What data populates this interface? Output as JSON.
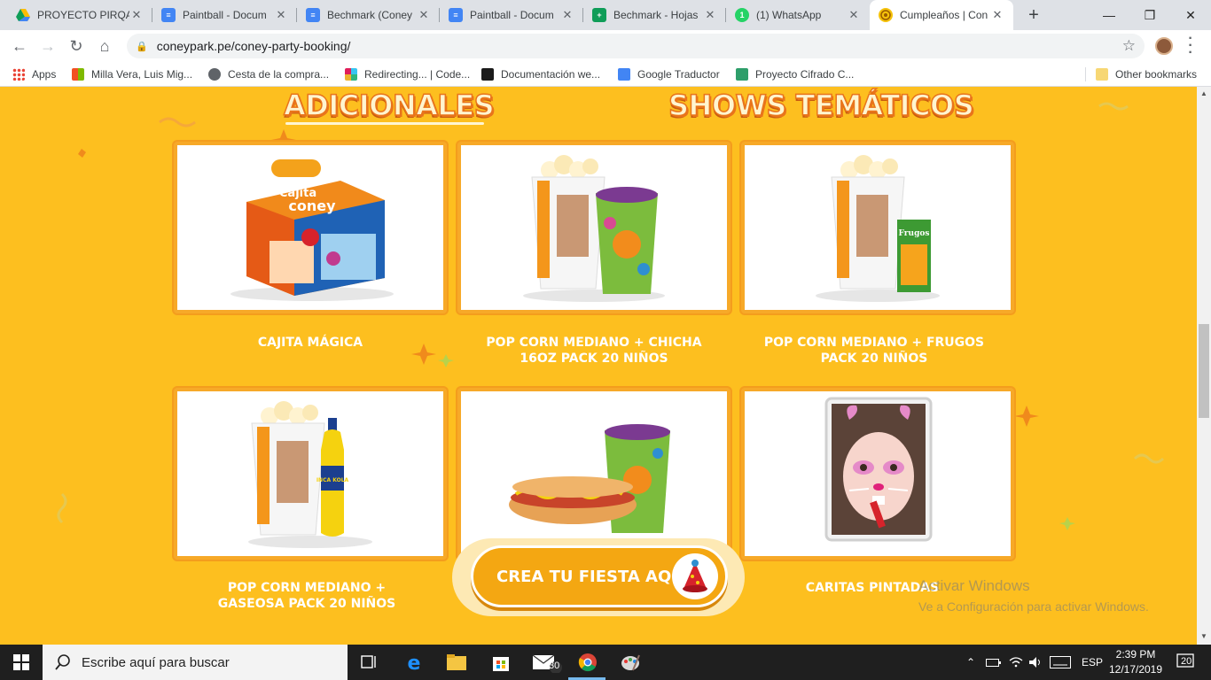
{
  "browser": {
    "tabs": [
      {
        "title": "PROYECTO PIRQA",
        "icon": "google-drive-icon"
      },
      {
        "title": "Paintball - Docum",
        "icon": "google-docs-icon"
      },
      {
        "title": "Bechmark (Coney",
        "icon": "google-docs-icon"
      },
      {
        "title": "Paintball - Docum",
        "icon": "google-docs-icon"
      },
      {
        "title": "Bechmark - Hojas",
        "icon": "google-sheets-icon"
      },
      {
        "title": "(1) WhatsApp",
        "icon": "whatsapp-icon",
        "badge": "1"
      },
      {
        "title": "Cumpleaños | Con",
        "icon": "coney-icon",
        "active": true
      }
    ],
    "close_glyph": "✕",
    "new_tab_glyph": "+",
    "window_controls": {
      "minimize": "—",
      "restore": "❐",
      "close": "✕"
    },
    "url": "coneypark.pe/coney-party-booking/",
    "bookmarks": [
      {
        "label": "Apps"
      },
      {
        "label": "Milla Vera, Luis Mig..."
      },
      {
        "label": "Cesta de la compra..."
      },
      {
        "label": "Redirecting... | Code..."
      },
      {
        "label": "Documentación we..."
      },
      {
        "label": "Google Traductor"
      },
      {
        "label": "Proyecto Cifrado C..."
      },
      {
        "label": "Other bookmarks"
      }
    ]
  },
  "page": {
    "headings": {
      "adicionales": "ADICIONALES",
      "shows": "SHOWS TEMÁTICOS"
    },
    "items": [
      {
        "label": "CAJITA MÁGICA",
        "image": "cajita-coney-box"
      },
      {
        "label": "POP CORN MEDIANO + CHICHA 16OZ PACK 20 NIÑOS",
        "image": "popcorn-chicha-cup"
      },
      {
        "label": "POP CORN MEDIANO + FRUGOS PACK 20 NIÑOS",
        "image": "popcorn-frugos-juice"
      },
      {
        "label": "POP CORN MEDIANO + GASEOSA PACK 20 NIÑOS",
        "image": "popcorn-inca-kola"
      },
      {
        "label": "",
        "image": "hotdog-cup"
      },
      {
        "label": "CARITAS PINTADAS",
        "image": "face-painting-girl"
      }
    ],
    "product_text": {
      "cajita_line1": "Cajita",
      "cajita_line2": "coney",
      "frugos": "Frugos",
      "inca_kola": "INCA KOLA"
    },
    "cta_label": "CREA TU FIESTA AQUÍ",
    "watermark": {
      "line1": "Activar Windows",
      "line2": "Ve a Configuración para activar Windows."
    }
  },
  "taskbar": {
    "search_placeholder": "Escribe aquí para buscar",
    "mail_badge": "30",
    "language": "ESP",
    "time": "2:39 PM",
    "date": "12/17/2019",
    "notification_count": "20"
  },
  "colors": {
    "page_bg": "#fdbf1f",
    "card_border": "#f7a928",
    "heading_outline": "#e9741b",
    "cta": "#f4a712"
  }
}
